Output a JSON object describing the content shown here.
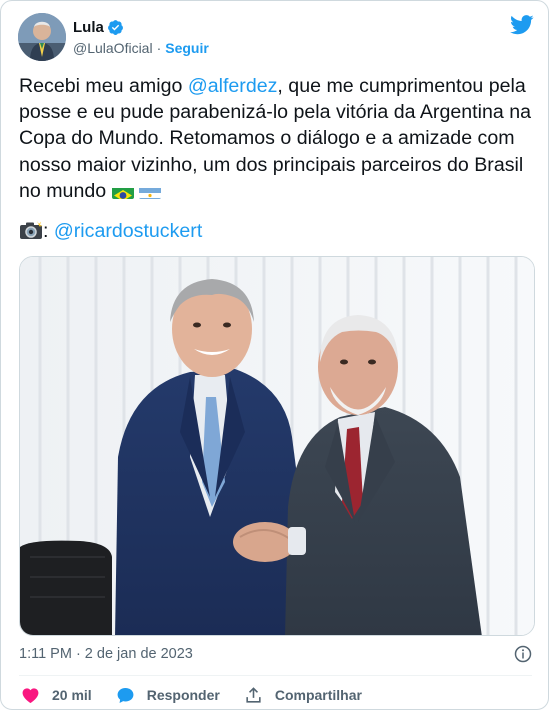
{
  "user": {
    "display_name": "Lula",
    "handle": "@LulaOficial",
    "separator": "·",
    "follow_label": "Seguir"
  },
  "tweet": {
    "text_before": "Recebi meu amigo ",
    "mention": "@alferdez",
    "text_after": ", que me cumprimentou pela posse e eu pude parabenizá-lo pela vitória da Argentina na Copa do Mundo. Retomamos o diálogo e a amizade com nosso maior vizinho, um dos principais parceiros do Brasil no mundo ",
    "credit_prefix": ": ",
    "credit_mention": "@ricardostuckert"
  },
  "icons": {
    "verified": "verified-badge-icon",
    "logo": "twitter-bird-icon",
    "flag_1": "brazil-flag-icon",
    "flag_2": "argentina-flag-icon",
    "camera": "camera-flash-icon",
    "info": "info-icon",
    "like": "heart-icon",
    "reply": "speech-bubble-icon",
    "share": "share-icon"
  },
  "timestamp": "1:11 PM · 2 de jan de 2023",
  "actions": {
    "likes": "20 mil",
    "reply_label": "Responder",
    "share_label": "Compartilhar"
  },
  "colors": {
    "accent": "#1d9bf0",
    "like": "#f91880",
    "secondary_text": "#536471"
  }
}
